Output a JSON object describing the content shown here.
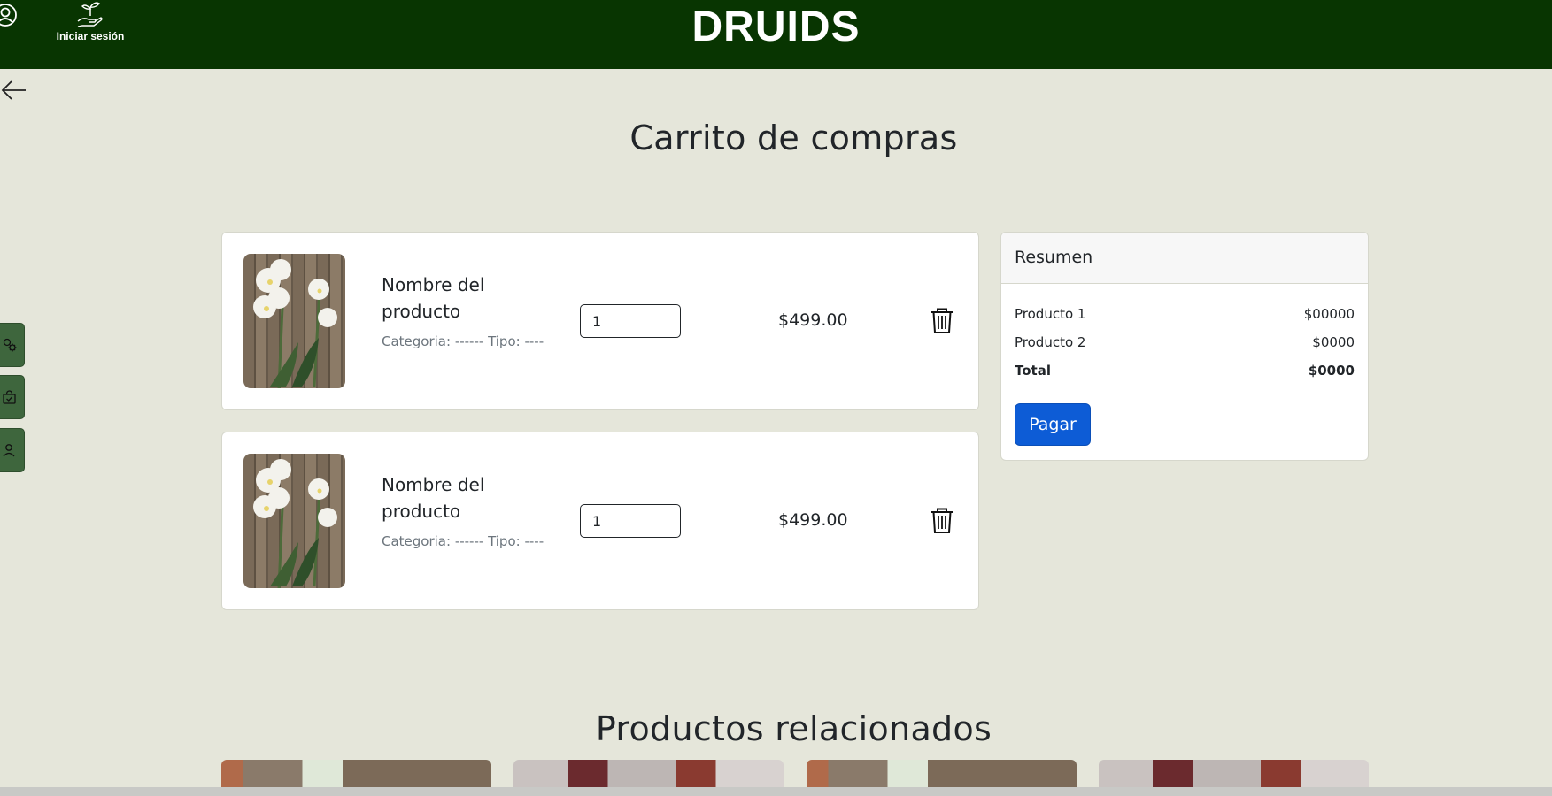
{
  "header": {
    "brand": "DRUIDS",
    "login_label": "Iniciar sesión"
  },
  "page": {
    "title": "Carrito de compras"
  },
  "cart": {
    "items": [
      {
        "name": "Nombre del producto",
        "meta": "Categoria: ------ Tipo: ----",
        "quantity": "1",
        "price": "$499.00"
      },
      {
        "name": "Nombre del producto",
        "meta": "Categoria: ------ Tipo: ----",
        "quantity": "1",
        "price": "$499.00"
      }
    ]
  },
  "summary": {
    "title": "Resumen",
    "rows": [
      {
        "label": "Producto 1",
        "value": "$00000"
      },
      {
        "label": "Producto 2",
        "value": "$0000"
      }
    ],
    "total_label": "Total",
    "total_value": "$0000",
    "pay_label": "Pagar"
  },
  "related": {
    "title": "Productos relacionados"
  },
  "colors": {
    "header_bg": "#083501",
    "page_bg": "#e5e6da",
    "side_button": "#3e663d",
    "primary_button": "#0d5cd6"
  },
  "icons": [
    "user-icon",
    "plant-hand-icon",
    "back-arrow-icon",
    "gear-icon",
    "bag-check-icon",
    "user-circle-icon",
    "trash-icon"
  ]
}
